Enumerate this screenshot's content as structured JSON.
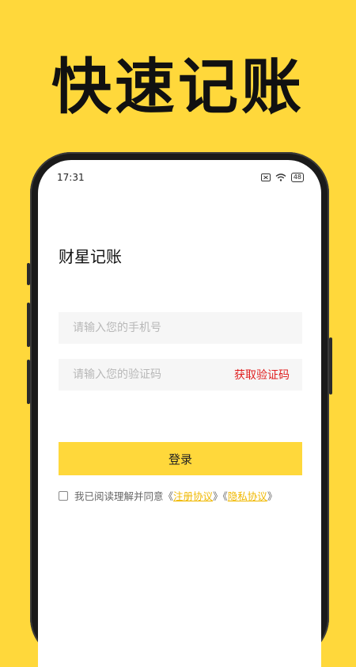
{
  "headline": "快速记账",
  "status_bar": {
    "time": "17:31",
    "battery": "48"
  },
  "app": {
    "title": "财星记账",
    "phone_placeholder": "请输入您的手机号",
    "code_placeholder": "请输入您的验证码",
    "get_code_label": "获取验证码",
    "login_label": "登录",
    "agreement": {
      "prefix": "我已阅读理解并同意《",
      "register_link": "注册协议",
      "middle": "》《",
      "privacy_link": "隐私协议",
      "suffix": "》"
    }
  },
  "colors": {
    "background": "#FFD83B",
    "accent_red": "#E02020",
    "link": "#F0B800"
  }
}
